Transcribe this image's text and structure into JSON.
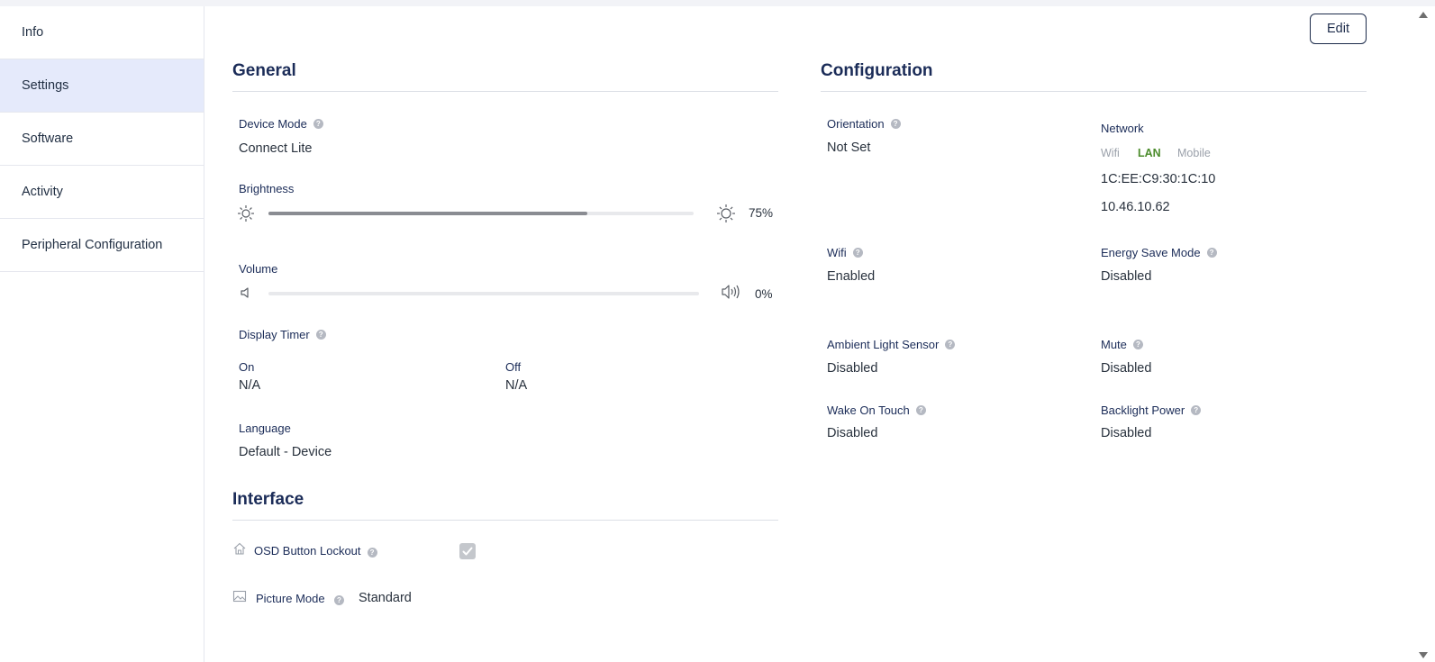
{
  "sidebar": {
    "items": [
      {
        "label": "Info"
      },
      {
        "label": "Settings"
      },
      {
        "label": "Software"
      },
      {
        "label": "Activity"
      },
      {
        "label": "Peripheral Configuration"
      }
    ],
    "active_index": 1
  },
  "toolbar": {
    "edit_label": "Edit"
  },
  "general": {
    "title": "General",
    "device_mode": {
      "label": "Device Mode",
      "value": "Connect Lite"
    },
    "brightness": {
      "label": "Brightness",
      "value_text": "75%",
      "level": 0.75
    },
    "volume": {
      "label": "Volume",
      "value_text": "0%",
      "level": 0.0
    },
    "display_timer": {
      "label": "Display Timer",
      "on_label": "On",
      "on_value": "N/A",
      "off_label": "Off",
      "off_value": "N/A"
    },
    "language": {
      "label": "Language",
      "value": "Default - Device"
    }
  },
  "interface": {
    "title": "Interface",
    "osd_lockout": {
      "label": "OSD Button Lockout",
      "checked": true
    },
    "picture_mode": {
      "label": "Picture Mode",
      "value": "Standard"
    }
  },
  "configuration": {
    "title": "Configuration",
    "orientation": {
      "label": "Orientation",
      "value": "Not Set"
    },
    "network": {
      "label": "Network",
      "options": [
        "Wifi",
        "LAN",
        "Mobile"
      ],
      "selected": "LAN",
      "mac": "1C:EE:C9:30:1C:10",
      "ip": "10.46.10.62"
    },
    "wifi": {
      "label": "Wifi",
      "value": "Enabled"
    },
    "energy_save": {
      "label": "Energy Save Mode",
      "value": "Disabled"
    },
    "ambient_light": {
      "label": "Ambient Light Sensor",
      "value": "Disabled"
    },
    "mute": {
      "label": "Mute",
      "value": "Disabled"
    },
    "wake_on_touch": {
      "label": "Wake On Touch",
      "value": "Disabled"
    },
    "backlight_power": {
      "label": "Backlight Power",
      "value": "Disabled"
    }
  },
  "colors": {
    "accent": "#1b2c58",
    "active_sidebar_bg": "#e5eafb",
    "network_selected": "#4c8c2c"
  },
  "icons": {
    "brightness_low": "sun-icon",
    "brightness_high": "sun-icon",
    "volume_low": "speaker-icon",
    "volume_high": "speaker-loud-icon",
    "osd": "home-icon",
    "picture": "image-icon",
    "help": "help-icon"
  }
}
